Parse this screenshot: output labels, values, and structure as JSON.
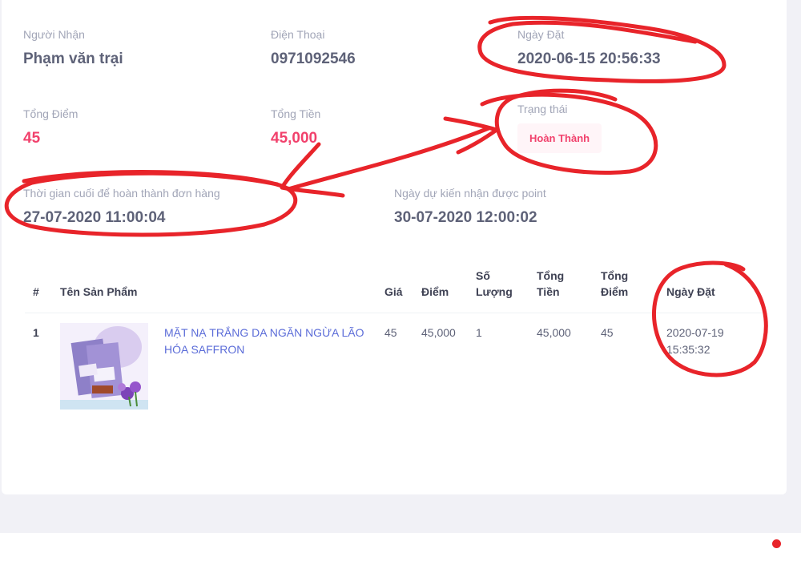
{
  "order": {
    "receiver": {
      "label": "Người Nhận",
      "value": "Phạm văn trại"
    },
    "phone": {
      "label": "Điện Thoại",
      "value": "0971092546"
    },
    "order_date": {
      "label": "Ngày Đặt",
      "value": "2020-06-15 20:56:33"
    },
    "total_points": {
      "label": "Tổng Điểm",
      "value": "45"
    },
    "total_amount": {
      "label": "Tổng Tiền",
      "value": "45,000"
    },
    "status": {
      "label": "Trạng thái",
      "value": "Hoàn Thành"
    },
    "deadline": {
      "label": "Thời gian cuối để hoàn thành đơn hàng",
      "value": "27-07-2020 11:00:04"
    },
    "expected_points_date": {
      "label": "Ngày dự kiến nhận được point",
      "value": "30-07-2020 12:00:02"
    }
  },
  "table": {
    "headers": {
      "index": "#",
      "product": "Tên Sản Phẩm",
      "price": "Giá",
      "points": "Điểm",
      "quantity": "Số Lượng",
      "total_amount": "Tổng Tiền",
      "total_points": "Tổng Điểm",
      "date": "Ngày Đặt"
    },
    "rows": [
      {
        "index": "1",
        "product": "MẶT NẠ TRẮNG DA NGĂN NGỪA LÃO HÓA SAFFRON",
        "price": "45",
        "points": "45,000",
        "quantity": "1",
        "total_amount": "45,000",
        "total_points": "45",
        "date": "2020-07-19 15:35:32"
      }
    ]
  },
  "colors": {
    "accent_pink": "#f1416c",
    "badge_bg": "#fff5f8",
    "link": "#5b6cd8",
    "annotation_red": "#e8242a"
  },
  "icons": [
    "product-thumbnail",
    "notification-dot"
  ]
}
